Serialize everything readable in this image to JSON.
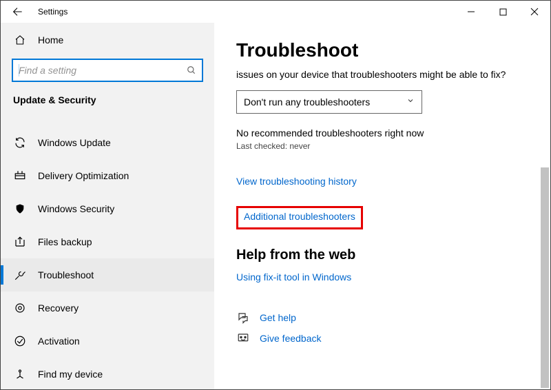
{
  "window": {
    "title": "Settings"
  },
  "sidebar": {
    "home": "Home",
    "search_placeholder": "Find a setting",
    "section": "Update & Security",
    "items": [
      {
        "label": "Windows Update"
      },
      {
        "label": "Delivery Optimization"
      },
      {
        "label": "Windows Security"
      },
      {
        "label": "Files backup"
      },
      {
        "label": "Troubleshoot"
      },
      {
        "label": "Recovery"
      },
      {
        "label": "Activation"
      },
      {
        "label": "Find my device"
      }
    ]
  },
  "main": {
    "heading": "Troubleshoot",
    "intro_line": "issues on your device that troubleshooters might be able to fix?",
    "dropdown_value": "Don't run any troubleshooters",
    "status": "No recommended troubleshooters right now",
    "last_checked": "Last checked: never",
    "history_link": "View troubleshooting history",
    "additional_link": "Additional troubleshooters",
    "help_heading": "Help from the web",
    "help_link": "Using fix-it tool in Windows",
    "get_help": "Get help",
    "give_feedback": "Give feedback"
  }
}
